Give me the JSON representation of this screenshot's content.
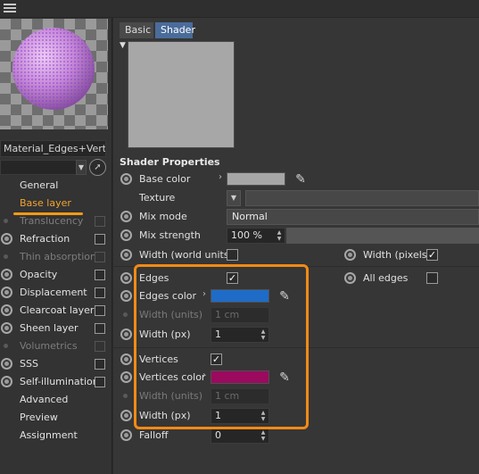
{
  "colors": {
    "accent": "#f29a18",
    "edges_color": "#1f6cc8",
    "vertices_color": "#9b0a5e",
    "base_color": "#a6a6a6",
    "tab_active": "#4a6c9a",
    "preview": "#a7a7a7"
  },
  "toolbar": {
    "menu_icon": "hamburger-icon"
  },
  "material": {
    "name": "Material_Edges+Vertex"
  },
  "sidebar": {
    "items": [
      {
        "label": "General",
        "marker": "none",
        "checkbox": false,
        "dim": false,
        "active": false
      },
      {
        "label": "Base layer",
        "marker": "none",
        "checkbox": false,
        "dim": false,
        "active": true
      },
      {
        "label": "Translucency",
        "marker": "dot",
        "checkbox": true,
        "dim": true,
        "active": false
      },
      {
        "label": "Refraction",
        "marker": "radio",
        "checkbox": true,
        "dim": false,
        "active": false
      },
      {
        "label": "Thin absorption",
        "marker": "dot",
        "checkbox": true,
        "dim": true,
        "active": false
      },
      {
        "label": "Opacity",
        "marker": "radio",
        "checkbox": true,
        "dim": false,
        "active": false
      },
      {
        "label": "Displacement",
        "marker": "radio",
        "checkbox": true,
        "dim": false,
        "active": false
      },
      {
        "label": "Clearcoat layer",
        "marker": "radio",
        "checkbox": true,
        "dim": false,
        "active": false
      },
      {
        "label": "Sheen layer",
        "marker": "radio",
        "checkbox": true,
        "dim": false,
        "active": false
      },
      {
        "label": "Volumetrics",
        "marker": "dot",
        "checkbox": true,
        "dim": true,
        "active": false
      },
      {
        "label": "SSS",
        "marker": "radio",
        "checkbox": true,
        "dim": false,
        "active": false
      },
      {
        "label": "Self-illumination",
        "marker": "radio",
        "checkbox": true,
        "dim": false,
        "active": false
      },
      {
        "label": "Advanced",
        "marker": "none",
        "checkbox": false,
        "dim": false,
        "active": false
      },
      {
        "label": "Preview",
        "marker": "none",
        "checkbox": false,
        "dim": false,
        "active": false
      },
      {
        "label": "Assignment",
        "marker": "none",
        "checkbox": false,
        "dim": false,
        "active": false
      }
    ]
  },
  "tabs": [
    {
      "label": "Basic",
      "active": false
    },
    {
      "label": "Shader",
      "active": true
    }
  ],
  "shader": {
    "section_title": "Shader Properties",
    "base_color_label": "Base color",
    "texture_label": "Texture",
    "mix_mode_label": "Mix mode",
    "mix_mode_value": "Normal",
    "mix_strength_label": "Mix strength",
    "mix_strength_value": "100 %",
    "width_world_units_label": "Width (world units)",
    "width_pixels_label": "Width (pixels)",
    "width_world_units_checked": false,
    "width_pixels_checked": true,
    "edges_label": "Edges",
    "edges_checked": true,
    "all_edges_label": "All edges",
    "all_edges_checked": false,
    "edges_color_label": "Edges color",
    "edges_width_units_label": "Width (units)",
    "edges_width_units_value": "1 cm",
    "edges_width_px_label": "Width (px)",
    "edges_width_px_value": "1",
    "vertices_label": "Vertices",
    "vertices_checked": true,
    "vertices_color_label": "Vertices color",
    "vertices_width_units_label": "Width (units)",
    "vertices_width_units_value": "1 cm",
    "vertices_width_px_label": "Width (px)",
    "vertices_width_px_value": "1",
    "falloff_label": "Falloff",
    "falloff_value": "0"
  }
}
